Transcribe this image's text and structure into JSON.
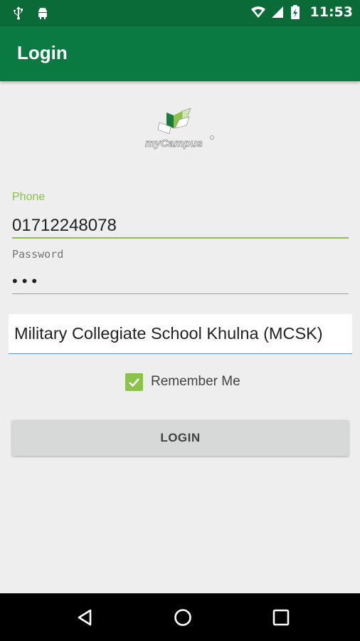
{
  "status_bar": {
    "time": "11:53",
    "left_icons": [
      "usb-icon",
      "android-icon"
    ],
    "right_icons": [
      "wifi-icon",
      "signal-icon",
      "battery-icon"
    ]
  },
  "app_bar": {
    "title": "Login",
    "color": "#0b7a42"
  },
  "logo": {
    "text": "myCampus"
  },
  "form": {
    "phone": {
      "label": "Phone",
      "value": "01712248078"
    },
    "password": {
      "label": "Password",
      "value": "•••"
    },
    "school": {
      "selected": "Military Collegiate School Khulna (MCSK)"
    },
    "remember_me": {
      "label": "Remember Me",
      "checked": true
    },
    "login_button": "LOGIN"
  },
  "colors": {
    "accent": "#8bc34a",
    "status_bar": "#0a6b39",
    "background": "#eeeeee",
    "button": "#d6d7d7"
  },
  "nav_bar": {
    "icons": [
      "back-icon",
      "home-icon",
      "recent-apps-icon"
    ]
  }
}
